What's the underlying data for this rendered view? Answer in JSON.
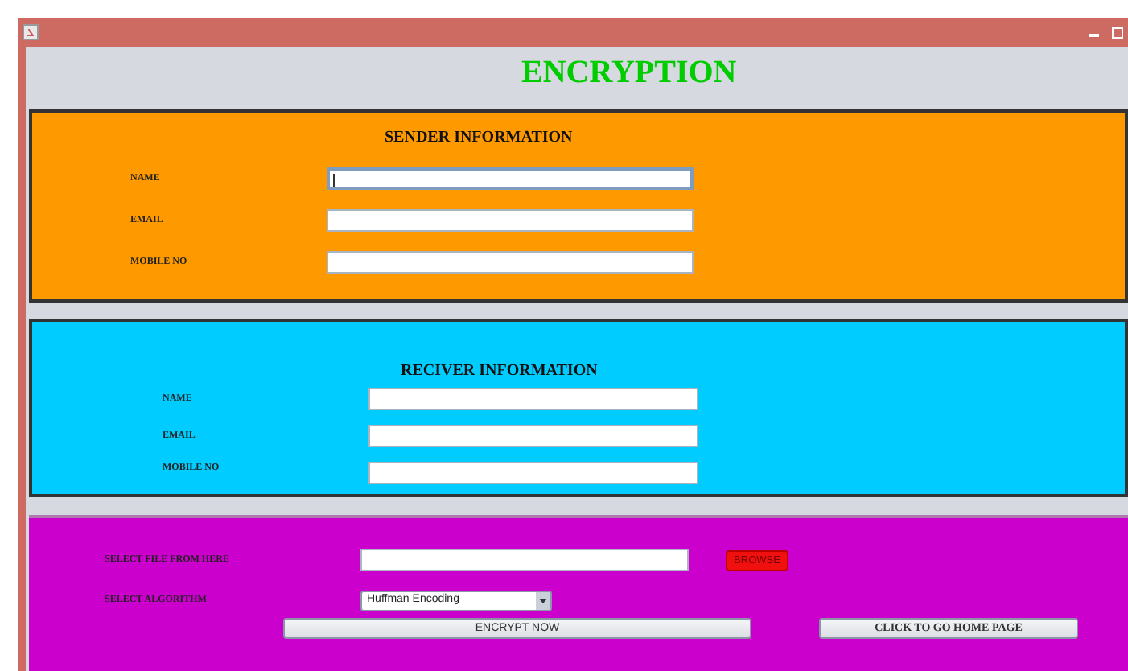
{
  "title": "ENCRYPTION",
  "sender": {
    "heading": "SENDER INFORMATION",
    "fields": [
      {
        "label": "NAME",
        "focused": true
      },
      {
        "label": "EMAIL",
        "focused": false
      },
      {
        "label": "MOBILE NO",
        "focused": false
      }
    ]
  },
  "receiver": {
    "heading": "RECIVER INFORMATION",
    "fields": [
      {
        "label": "NAME",
        "focused": false
      },
      {
        "label": "EMAIL",
        "focused": false
      },
      {
        "label": "MOBILE NO",
        "focused": false
      }
    ]
  },
  "file": {
    "label": "SELECT FILE FROM HERE",
    "browse": "BROWSE"
  },
  "algorithm": {
    "label": "SELECT ALGORITHM",
    "value": "Huffman Encoding"
  },
  "buttons": [
    {
      "label": "ENCRYPT NOW",
      "kind": "sans"
    },
    {
      "label": "CLICK TO GO HOME PAGE",
      "kind": "serif"
    }
  ]
}
